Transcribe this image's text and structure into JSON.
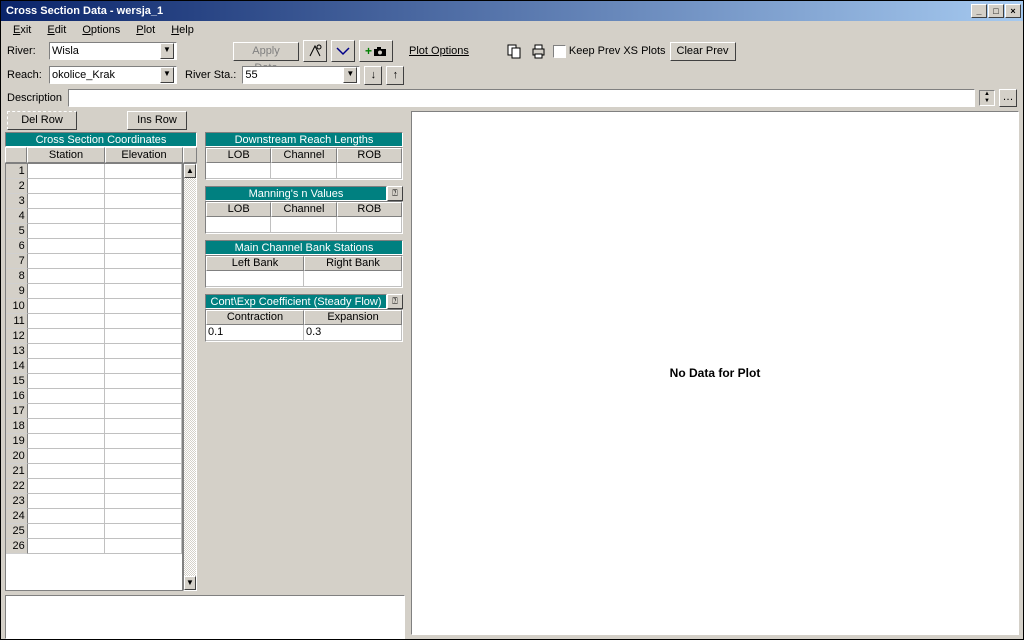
{
  "window": {
    "title": "Cross Section Data - wersja_1"
  },
  "menu": {
    "exit": "Exit",
    "edit": "Edit",
    "options": "Options",
    "plot": "Plot",
    "help": "Help"
  },
  "top": {
    "river_label": "River:",
    "river_value": "Wisla",
    "reach_label": "Reach:",
    "reach_value": "okolice_Krak",
    "riversta_label": "River Sta.:",
    "riversta_value": "55",
    "apply_data": "Apply Data",
    "plot_options": "Plot Options",
    "keep_prev": "Keep Prev XS Plots",
    "clear_prev": "Clear Prev"
  },
  "desc": {
    "label": "Description"
  },
  "rowbtns": {
    "del": "Del Row",
    "ins": "Ins Row"
  },
  "grid": {
    "title": "Cross Section Coordinates",
    "col1": "Station",
    "col2": "Elevation",
    "rows": 26
  },
  "boxes": {
    "downstream": {
      "title": "Downstream Reach Lengths",
      "h1": "LOB",
      "h2": "Channel",
      "h3": "ROB"
    },
    "mannings": {
      "title": "Manning's n Values",
      "h1": "LOB",
      "h2": "Channel",
      "h3": "ROB"
    },
    "banks": {
      "title": "Main Channel Bank Stations",
      "h1": "Left Bank",
      "h2": "Right Bank"
    },
    "contexp": {
      "title": "Cont\\Exp Coefficient (Steady Flow)",
      "h1": "Contraction",
      "h2": "Expansion",
      "v1": "0.1",
      "v2": "0.3"
    }
  },
  "plot": {
    "no_data": "No Data for Plot"
  }
}
